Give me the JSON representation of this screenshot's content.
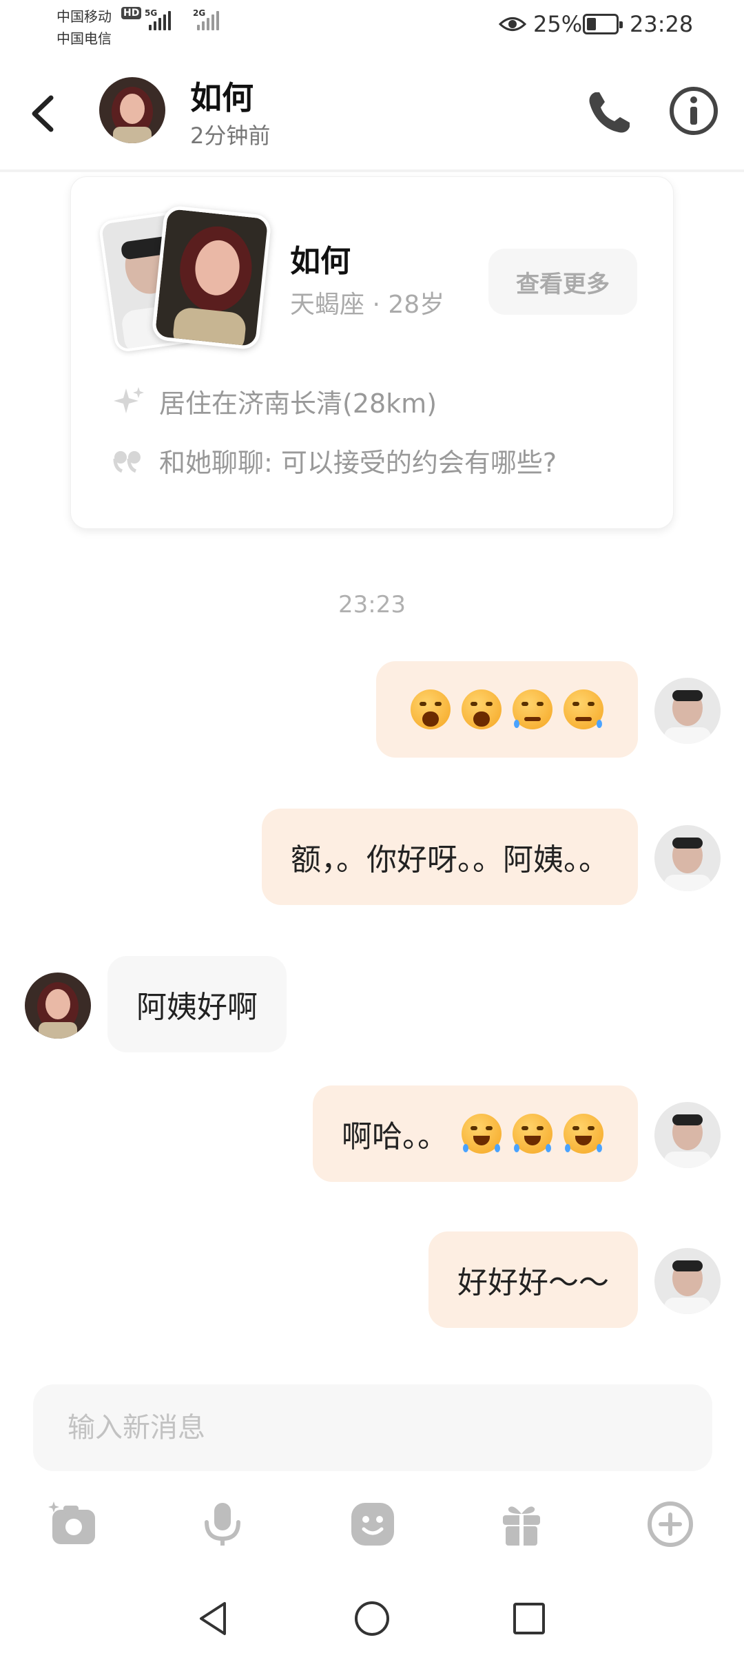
{
  "status_bar": {
    "carrier_1": "中国移动",
    "carrier_1_badge": "HD",
    "carrier_2": "中国电信",
    "signal_1_label": "5G",
    "signal_2_label": "2G",
    "battery_percent": "25%",
    "battery_level": 0.25,
    "time": "23:28"
  },
  "header": {
    "name": "如何",
    "last_seen": "2分钟前"
  },
  "profile_card": {
    "name": "如何",
    "meta": "天蝎座 · 28岁",
    "more_label": "查看更多",
    "location": "居住在济南长清(28km)",
    "prompt": "和她聊聊: 可以接受的约会有哪些?"
  },
  "timestamp": "23:23",
  "messages": [
    {
      "from": "me",
      "text": "",
      "emojis": [
        "shocked",
        "shocked",
        "crying",
        "crying"
      ]
    },
    {
      "from": "me",
      "text": "额，。你好呀。。阿姨。。",
      "emojis": []
    },
    {
      "from": "her",
      "text": "阿姨好啊",
      "emojis": []
    },
    {
      "from": "me",
      "text": "啊哈。。",
      "emojis": [
        "laughing-tears",
        "laughing-tears",
        "laughing-tears"
      ]
    },
    {
      "from": "me",
      "text": "好好好～～",
      "emojis": []
    }
  ],
  "composer": {
    "placeholder": "输入新消息",
    "toolbar_icons": [
      "camera-icon",
      "microphone-icon",
      "emoji-icon",
      "gift-icon",
      "plus-icon"
    ]
  },
  "colors": {
    "outgoing_bubble": "#fdeee2",
    "incoming_bubble": "#f7f7f7",
    "icon_gray": "#bdbdbd"
  }
}
